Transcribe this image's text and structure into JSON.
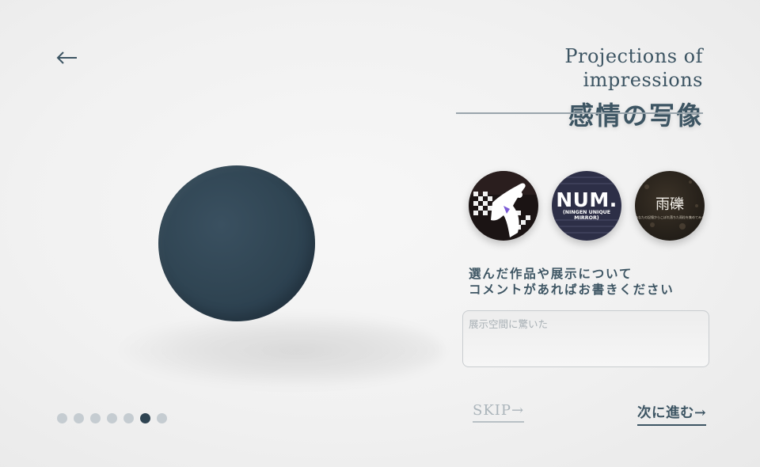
{
  "header": {
    "title_en": "Projections of impressions",
    "title_jp": "感情の写像"
  },
  "icons": {
    "back": "arrow-left-icon"
  },
  "colors": {
    "accent": "#2f4452",
    "text": "#3d5563",
    "dot_inactive": "#c5ccd1",
    "muted": "#aab4ba"
  },
  "works": [
    {
      "name": "dance-figure-artwork"
    },
    {
      "title": "NUM.",
      "subtitle": "(NINGEN UNIQUE MIRROR)"
    },
    {
      "title": "雨礫",
      "subtitle": "あなたの記憶からこぼれ落ちた雨粒を集めてみる"
    }
  ],
  "prompt": {
    "line1": "選んだ作品や展示について",
    "line2": "コメントがあればお書きください"
  },
  "comment": {
    "placeholder": "展示空間に驚いた",
    "value": ""
  },
  "progress": {
    "total_steps": 7,
    "current_step": 6
  },
  "actions": {
    "skip": "SKIP→",
    "next": "次に進む→"
  }
}
